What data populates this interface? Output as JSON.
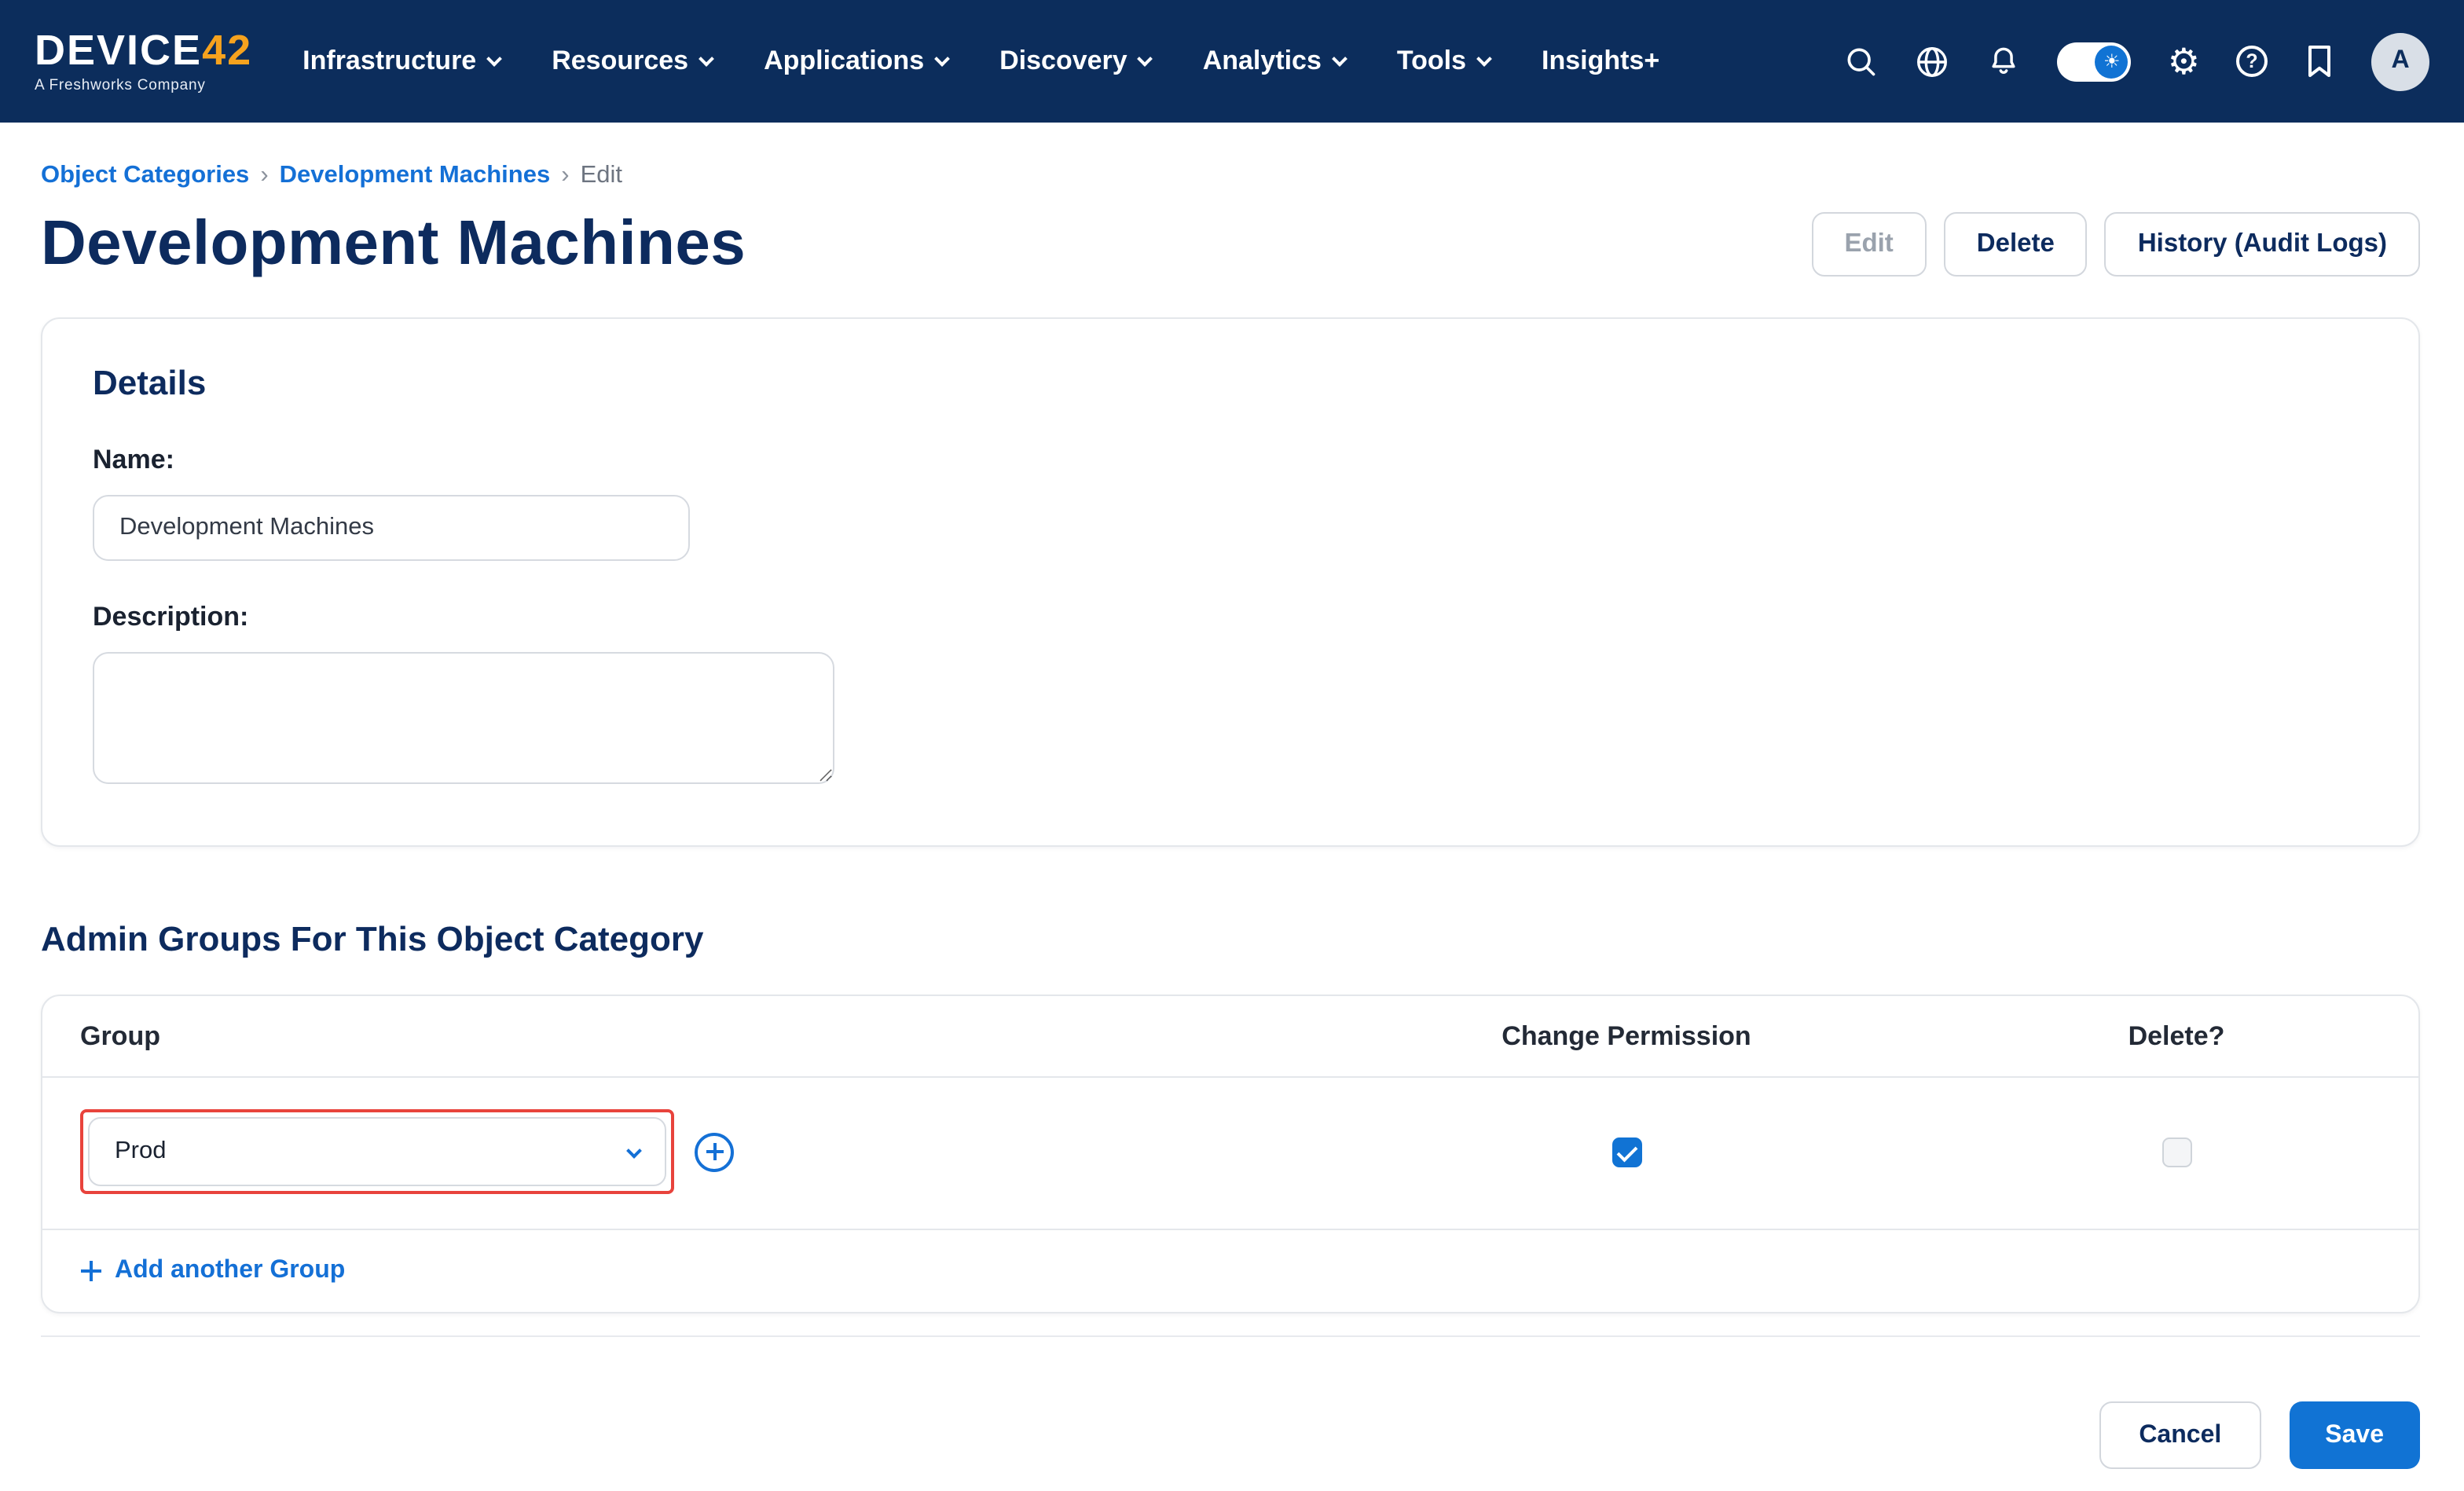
{
  "navbar": {
    "logo": {
      "brand": "DEVICE",
      "brand_accent": "42",
      "tagline": "A Freshworks Company"
    },
    "menus": [
      {
        "label": "Infrastructure",
        "has_chevron": true
      },
      {
        "label": "Resources",
        "has_chevron": true
      },
      {
        "label": "Applications",
        "has_chevron": true
      },
      {
        "label": "Discovery",
        "has_chevron": true
      },
      {
        "label": "Analytics",
        "has_chevron": true
      },
      {
        "label": "Tools",
        "has_chevron": true
      },
      {
        "label": "Insights+",
        "has_chevron": false
      }
    ],
    "icons": [
      "search-icon",
      "globe-icon",
      "bell-icon",
      "theme-toggle",
      "gear-icon",
      "help-icon",
      "bookmark-icon"
    ],
    "avatar_initial": "A"
  },
  "breadcrumb": {
    "items": [
      {
        "label": "Object Categories"
      },
      {
        "label": "Development Machines"
      }
    ],
    "current": "Edit",
    "separator": "›"
  },
  "header": {
    "title": "Development Machines",
    "actions": [
      {
        "label": "Edit",
        "disabled": true
      },
      {
        "label": "Delete",
        "disabled": false
      },
      {
        "label": "History (Audit Logs)",
        "disabled": false
      }
    ]
  },
  "details": {
    "heading": "Details",
    "name_label": "Name:",
    "name_value": "Development Machines",
    "description_label": "Description:",
    "description_value": ""
  },
  "admin_groups": {
    "heading": "Admin Groups For This Object Category",
    "columns": [
      "Group",
      "Change Permission",
      "Delete?"
    ],
    "rows": [
      {
        "group": "Prod",
        "change_permission": true,
        "delete": false,
        "highlighted": true
      }
    ],
    "add_link_label": "Add another Group"
  },
  "footer": {
    "cancel": "Cancel",
    "save": "Save"
  },
  "colors": {
    "navbar_bg": "#0c2d5c",
    "brand_orange": "#f6a21e",
    "link_blue": "#1470d6",
    "primary_blue": "#1173d4",
    "title_navy": "#0d2b5e",
    "highlight_red": "#e8433c"
  }
}
